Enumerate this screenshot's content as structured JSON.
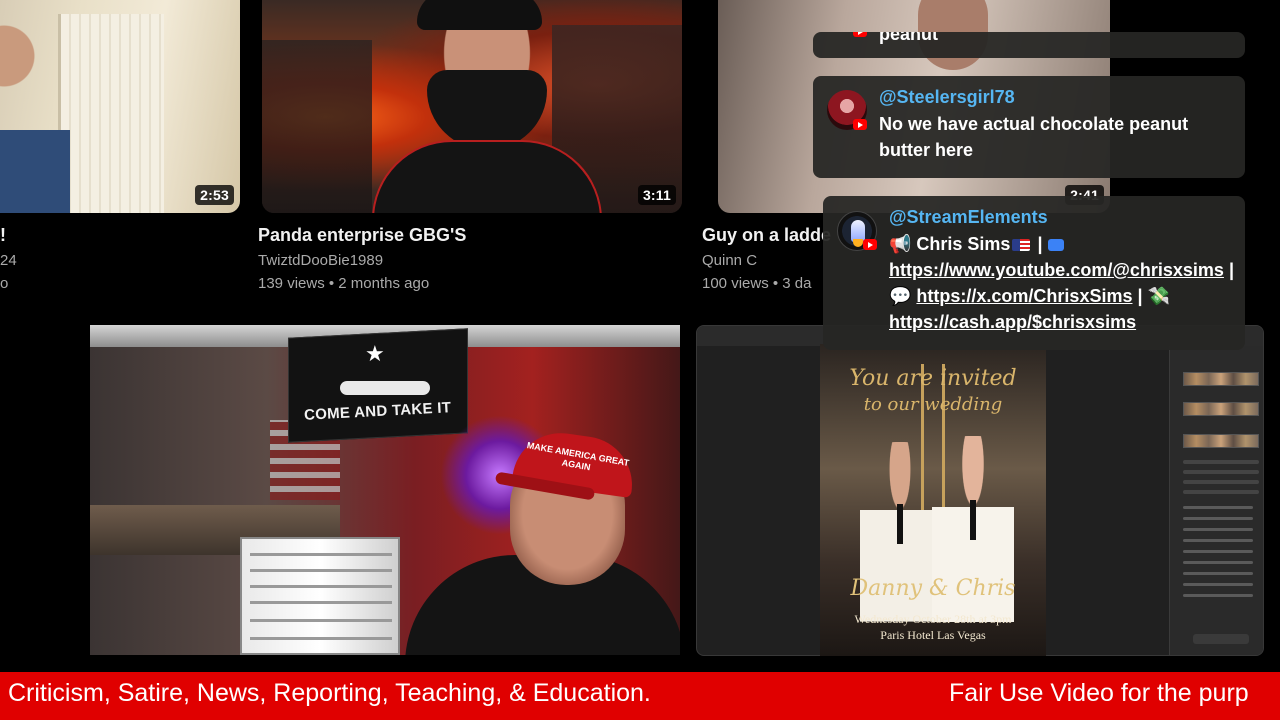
{
  "videos": [
    {
      "title": "!",
      "channel": "24",
      "meta": "o",
      "duration": "2:53"
    },
    {
      "title": "Panda enterprise GBG'S",
      "channel": "TwiztdDooBie1989",
      "meta": "139 views • 2 months ago",
      "duration": "3:11"
    },
    {
      "title": "Guy on a ladde",
      "channel": "Quinn C",
      "meta": "100 views • 3 da",
      "duration": "2:41"
    }
  ],
  "webcam": {
    "flag_text": "COME AND TAKE IT",
    "flag_star": "★",
    "hat_text": "MAKE AMERICA GREAT AGAIN"
  },
  "editor": {
    "invite_line1": "You are invited",
    "invite_line2": "to our wedding",
    "names": "Danny & Chris",
    "date": "Wednesday October 28th at 3pm",
    "venue": "Paris Hotel Las Vegas"
  },
  "chat": {
    "partial_message": "peanut",
    "messages": [
      {
        "user": "@Steelersgirl78",
        "text": "No we have actual chocolate peanut butter here"
      },
      {
        "user": "@StreamElements",
        "prefix": "📢 Chris Sims",
        "sep1": " | ",
        "link1": "https://www.youtube.com/@chrisxsims",
        "sep2": " | 💬 ",
        "link2": "https://x.com/ChrisxSims",
        "sep3": " | 💸 ",
        "link3": "https://cash.app/$chrisxsims"
      }
    ]
  },
  "ticker": {
    "segment1": "Criticism, Satire, News, Reporting, Teaching, & Education.",
    "segment2": "Fair Use Video for the purp"
  },
  "colors": {
    "ticker_bg": "#e00000",
    "chat_username": "#56b6f2",
    "youtube_red": "#ff0000"
  }
}
